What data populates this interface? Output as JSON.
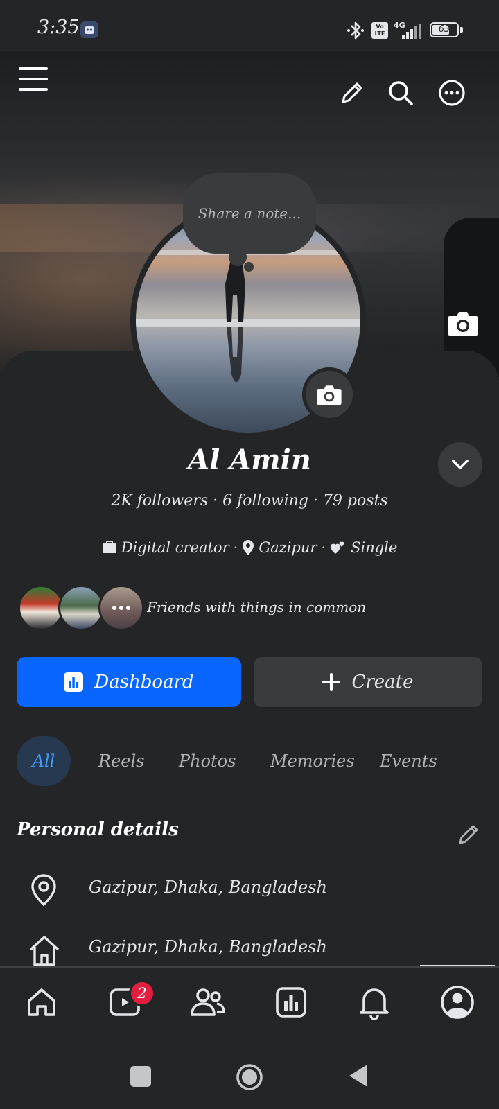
{
  "status_bar": {
    "time": "3:35",
    "battery": "63",
    "network": "4G",
    "volte": "Vo LTE"
  },
  "header": {
    "menu_icon": "hamburger-icon",
    "edit_icon": "pencil-icon",
    "search_icon": "search-icon",
    "more_icon": "more-icon"
  },
  "note": {
    "placeholder": "Share a note..."
  },
  "profile": {
    "name": "Al Amin",
    "stats": "2K followers · 6 following · 79 posts",
    "details": {
      "category": "Digital creator",
      "location": "Gazipur",
      "relationship": "Single"
    },
    "friends_text": "Friends with things in common"
  },
  "actions": {
    "dashboard_label": "Dashboard",
    "create_label": "Create"
  },
  "tabs": [
    {
      "label": "All",
      "active": true
    },
    {
      "label": "Reels",
      "active": false
    },
    {
      "label": "Photos",
      "active": false
    },
    {
      "label": "Memories",
      "active": false
    },
    {
      "label": "Events",
      "active": false
    }
  ],
  "personal_details": {
    "title": "Personal details",
    "rows": [
      {
        "icon": "location-pin-icon",
        "text": "Gazipur, Dhaka, Bangladesh"
      },
      {
        "icon": "home-icon",
        "text": "Gazipur, Dhaka, Bangladesh"
      }
    ]
  },
  "bottom_nav": {
    "items": [
      {
        "icon": "home-icon"
      },
      {
        "icon": "video-icon",
        "badge": "2"
      },
      {
        "icon": "friends-icon"
      },
      {
        "icon": "dashboard-icon"
      },
      {
        "icon": "bell-icon"
      },
      {
        "icon": "profile-icon"
      }
    ]
  },
  "colors": {
    "background": "#242526",
    "accent": "#0866ff",
    "secondary_button": "#3a3b3c",
    "badge": "#e41e3f",
    "active_tab_bg": "#263951",
    "active_tab_text": "#4599ff"
  }
}
